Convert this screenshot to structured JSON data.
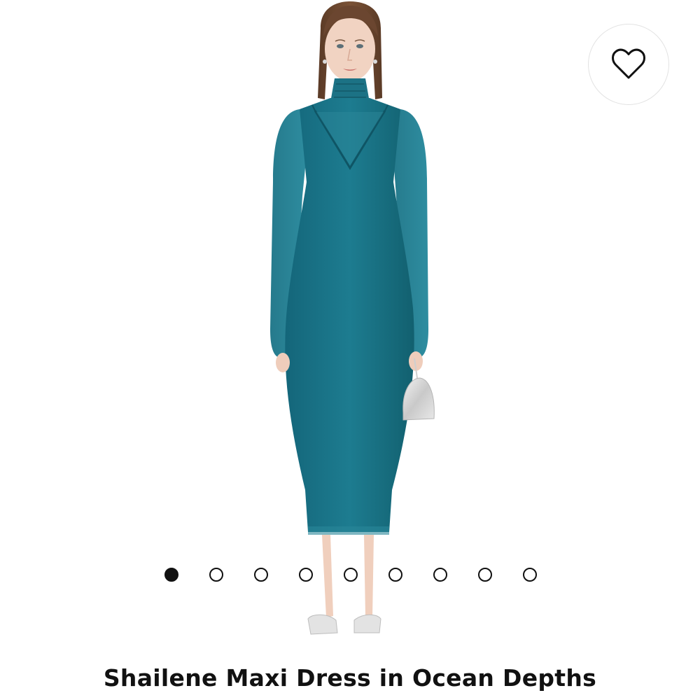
{
  "product": {
    "title": "Shailene Maxi Dress in Ocean Depths",
    "image_alt": "Model wearing teal mesh maxi dress with turtleneck, long sleeves, silver bag and clear heeled sandals",
    "dress_color": "#1b7487"
  },
  "wishlist": {
    "icon": "heart-outline-icon"
  },
  "carousel": {
    "total_slides": 9,
    "active_index": 0
  }
}
